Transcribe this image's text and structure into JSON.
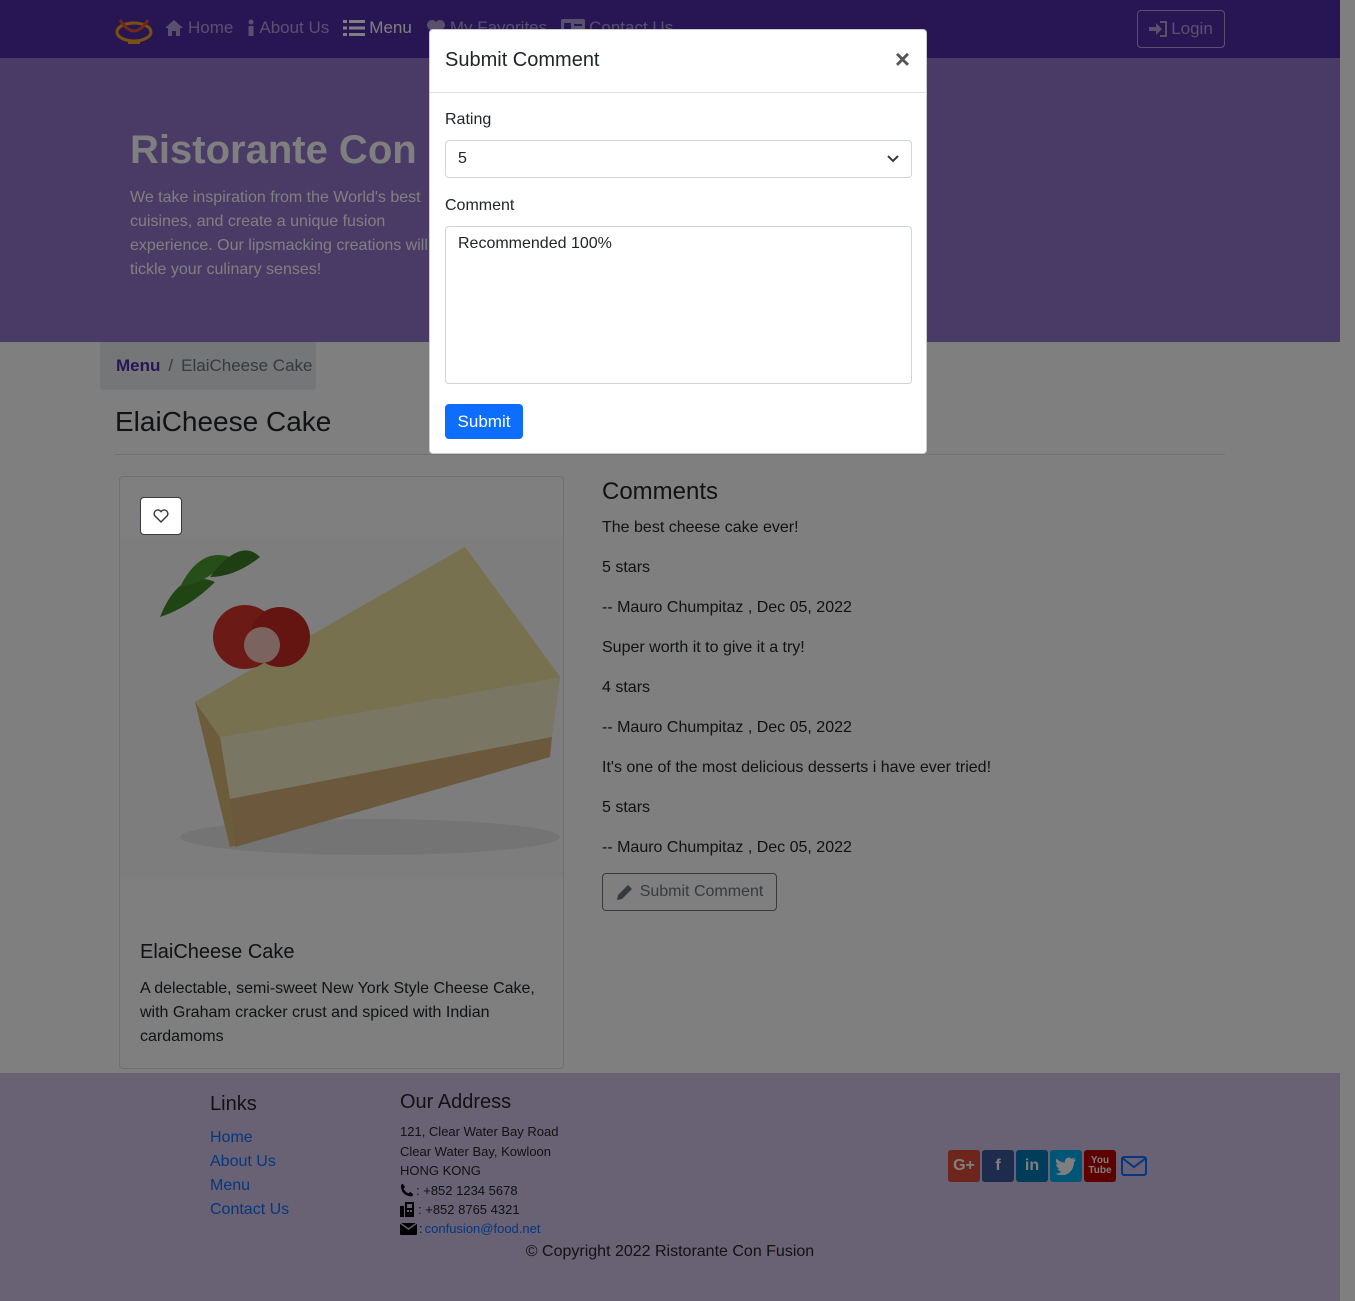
{
  "navbar": {
    "items": [
      {
        "label": "Home",
        "icon": "home-icon"
      },
      {
        "label": "About Us",
        "icon": "info-icon"
      },
      {
        "label": "Menu",
        "icon": "list-icon"
      },
      {
        "label": "My Favorites",
        "icon": "heart-icon"
      },
      {
        "label": "Contact Us",
        "icon": "address-card-icon"
      }
    ],
    "login_label": "Login"
  },
  "jumbotron": {
    "title": "Ristorante Con Fusion",
    "text": "We take inspiration from the World's best cuisines, and create a unique fusion experience. Our lipsmacking creations will tickle your culinary senses!"
  },
  "breadcrumb": {
    "link": "Menu",
    "separator": "/",
    "current": "ElaiCheese Cake"
  },
  "page_title": "ElaiCheese Cake",
  "dish": {
    "name": "ElaiCheese Cake",
    "description": "A delectable, semi-sweet New York Style Cheese Cake, with Graham cracker crust and spiced with Indian cardamoms"
  },
  "comments": {
    "heading": "Comments",
    "items": [
      {
        "text": "The best cheese cake ever!",
        "rating": "5 stars",
        "author": "-- Mauro Chumpitaz , Dec 05, 2022"
      },
      {
        "text": "Super worth it to give it a try!",
        "rating": "4 stars",
        "author": "-- Mauro Chumpitaz , Dec 05, 2022"
      },
      {
        "text": "It's one of the most delicious desserts i have ever tried!",
        "rating": "5 stars",
        "author": "-- Mauro Chumpitaz , Dec 05, 2022"
      }
    ],
    "submit_label": "Submit Comment"
  },
  "footer": {
    "links_heading": "Links",
    "links": [
      "Home",
      "About Us",
      "Menu",
      "Contact Us"
    ],
    "address_heading": "Our Address",
    "address_lines": [
      "121, Clear Water Bay Road",
      "Clear Water Bay, Kowloon",
      "HONG KONG"
    ],
    "phone": ": +852 1234 5678",
    "fax": ": +852 8765 4321",
    "email_prefix": ": ",
    "email": "confusion@food.net",
    "copyright": "© Copyright 2022 Ristorante Con Fusion"
  },
  "modal": {
    "title": "Submit Comment",
    "close": "×",
    "rating_label": "Rating",
    "rating_value": "5",
    "comment_label": "Comment",
    "comment_value": "Recommended 100%",
    "submit_label": "Submit"
  },
  "colors": {
    "primary": "#512da8",
    "jumbotron": "#9575cd",
    "footer": "#d1c4e9",
    "button_blue": "#0d6efd"
  }
}
